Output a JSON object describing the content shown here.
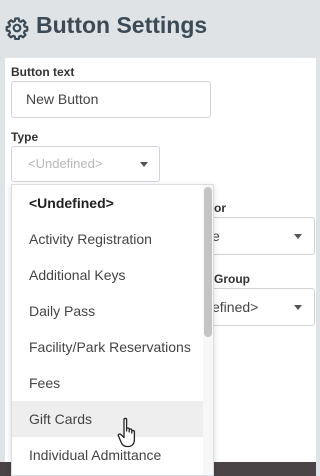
{
  "header": {
    "title": "Button Settings",
    "icon": "gear-icon"
  },
  "form": {
    "button_text_label": "Button text",
    "button_text_value": "New Button",
    "type_label": "Type",
    "type_value": "<Undefined>",
    "color_label_partial": "or",
    "color_value_partial": "e",
    "group_label_partial": "Group",
    "group_value_partial": "efined>"
  },
  "dropdown": {
    "options": [
      "<Undefined>",
      "Activity Registration",
      "Additional Keys",
      "Daily Pass",
      "Facility/Park Reservations",
      "Fees",
      "Gift Cards",
      "Individual Admittance"
    ],
    "selected_index": 0,
    "hovered_index": 6
  }
}
